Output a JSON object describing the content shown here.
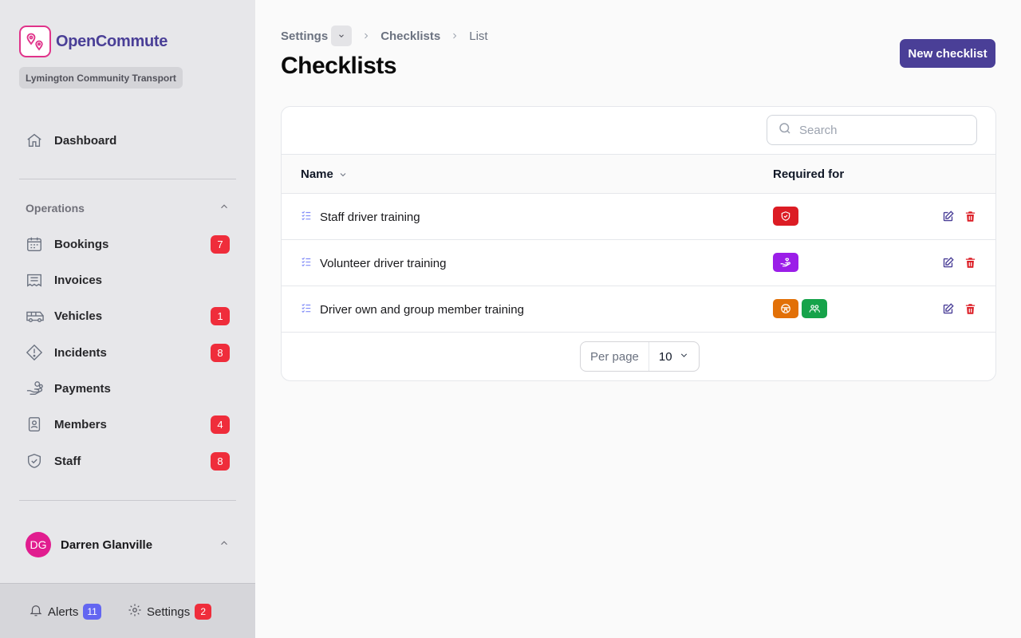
{
  "app": {
    "name": "OpenCommute",
    "organization": "Lymington Community Transport"
  },
  "sidebar": {
    "dashboard": {
      "label": "Dashboard",
      "icon": "home-icon"
    },
    "group": {
      "label": "Operations",
      "expanded": true
    },
    "items": [
      {
        "label": "Bookings",
        "icon": "calendar-icon",
        "badge": "7"
      },
      {
        "label": "Invoices",
        "icon": "receipt-icon",
        "badge": ""
      },
      {
        "label": "Vehicles",
        "icon": "bus-icon",
        "badge": "1"
      },
      {
        "label": "Incidents",
        "icon": "warning-icon",
        "badge": "8"
      },
      {
        "label": "Payments",
        "icon": "hand-coins-icon",
        "badge": ""
      },
      {
        "label": "Members",
        "icon": "id-badge-icon",
        "badge": "4"
      },
      {
        "label": "Staff",
        "icon": "shield-check-icon",
        "badge": "8"
      }
    ],
    "user": {
      "initials": "DG",
      "name": "Darren Glanville"
    },
    "bottom": {
      "alerts": {
        "label": "Alerts",
        "count": "11",
        "color": "#6366f1"
      },
      "settings": {
        "label": "Settings",
        "count": "2",
        "color": "#ef2d3b"
      }
    }
  },
  "breadcrumb": [
    "Settings",
    "Checklists",
    "List"
  ],
  "page": {
    "title": "Checklists",
    "new_button": "New checklist"
  },
  "table": {
    "search_placeholder": "Search",
    "columns": {
      "name": "Name",
      "required_for": "Required for"
    },
    "rows": [
      {
        "name": "Staff driver training",
        "tags": [
          {
            "icon": "shield-icon",
            "color": "#dc1c24"
          }
        ]
      },
      {
        "name": "Volunteer driver training",
        "tags": [
          {
            "icon": "hand-heart-icon",
            "color": "#9b1ee8"
          }
        ]
      },
      {
        "name": "Driver own and group member training",
        "tags": [
          {
            "icon": "steering-wheel-icon",
            "color": "#e27007"
          },
          {
            "icon": "users-icon",
            "color": "#16a34a"
          }
        ]
      }
    ],
    "pagination": {
      "label": "Per page",
      "value": "10"
    }
  },
  "colors": {
    "brand": "#4a3f97",
    "logo": "#e0338a",
    "badge": "#ef2d3b",
    "edit": "#4a3f97",
    "delete": "#dc1c24"
  }
}
